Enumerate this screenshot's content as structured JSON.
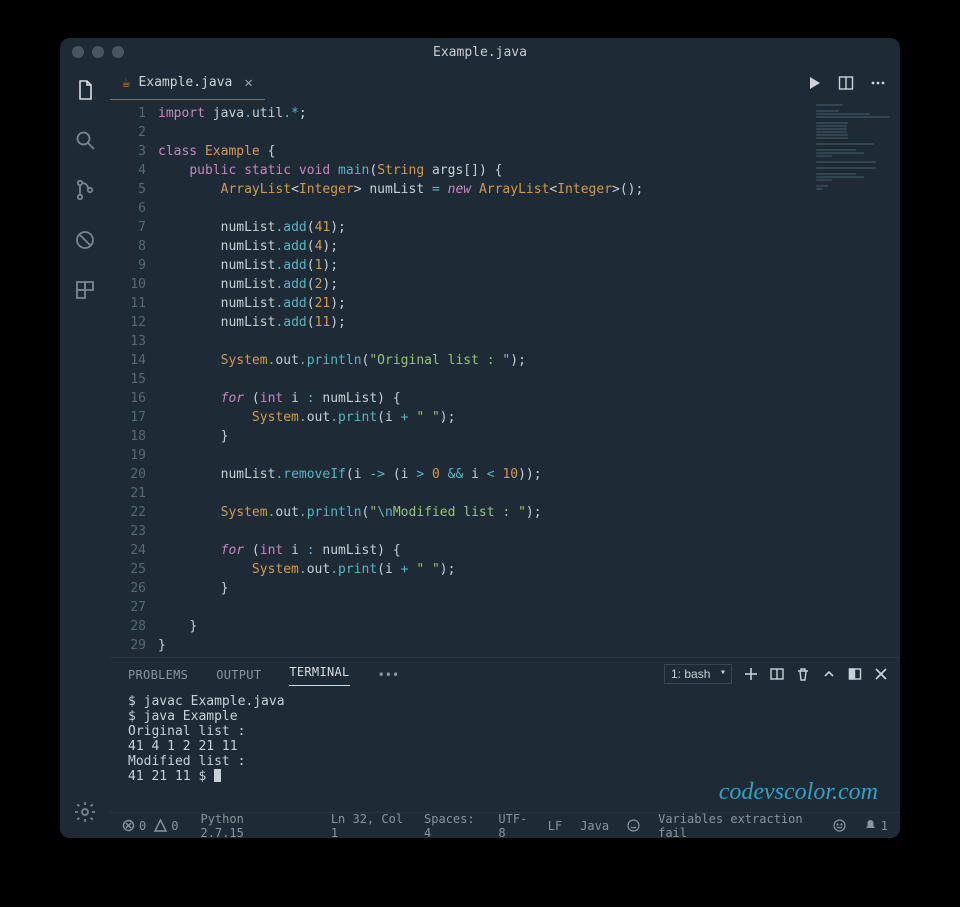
{
  "title": "Example.java",
  "tabs": [
    {
      "label": "Example.java",
      "dirty": false
    }
  ],
  "editor": {
    "lines": [
      [
        {
          "t": "kw",
          "s": "import"
        },
        {
          "t": "",
          "s": " java"
        },
        {
          "t": "op",
          "s": "."
        },
        {
          "t": "",
          "s": "util"
        },
        {
          "t": "op",
          "s": "."
        },
        {
          "t": "op",
          "s": "*"
        },
        {
          "t": "",
          "s": ";"
        }
      ],
      [],
      [
        {
          "t": "kw",
          "s": "class"
        },
        {
          "t": "",
          "s": " "
        },
        {
          "t": "cls",
          "s": "Example"
        },
        {
          "t": "",
          "s": " {"
        }
      ],
      [
        {
          "t": "ind",
          "s": "    "
        },
        {
          "t": "kw",
          "s": "public"
        },
        {
          "t": "",
          "s": " "
        },
        {
          "t": "kw",
          "s": "static"
        },
        {
          "t": "",
          "s": " "
        },
        {
          "t": "kw",
          "s": "void"
        },
        {
          "t": "",
          "s": " "
        },
        {
          "t": "fn",
          "s": "main"
        },
        {
          "t": "",
          "s": "("
        },
        {
          "t": "type",
          "s": "String"
        },
        {
          "t": "",
          "s": " args"
        },
        {
          "t": "",
          "s": "[]) {"
        }
      ],
      [
        {
          "t": "ind",
          "s": "        "
        },
        {
          "t": "type",
          "s": "ArrayList"
        },
        {
          "t": "",
          "s": "<"
        },
        {
          "t": "type",
          "s": "Integer"
        },
        {
          "t": "",
          "s": "> numList "
        },
        {
          "t": "op",
          "s": "="
        },
        {
          "t": "",
          "s": " "
        },
        {
          "t": "new",
          "s": "new"
        },
        {
          "t": "",
          "s": " "
        },
        {
          "t": "type",
          "s": "ArrayList"
        },
        {
          "t": "",
          "s": "<"
        },
        {
          "t": "type",
          "s": "Integer"
        },
        {
          "t": "",
          "s": ">();"
        }
      ],
      [],
      [
        {
          "t": "ind",
          "s": "        "
        },
        {
          "t": "",
          "s": "numList"
        },
        {
          "t": "op",
          "s": "."
        },
        {
          "t": "fn",
          "s": "add"
        },
        {
          "t": "",
          "s": "("
        },
        {
          "t": "num",
          "s": "41"
        },
        {
          "t": "",
          "s": ");"
        }
      ],
      [
        {
          "t": "ind",
          "s": "        "
        },
        {
          "t": "",
          "s": "numList"
        },
        {
          "t": "op",
          "s": "."
        },
        {
          "t": "fn",
          "s": "add"
        },
        {
          "t": "",
          "s": "("
        },
        {
          "t": "num",
          "s": "4"
        },
        {
          "t": "",
          "s": ");"
        }
      ],
      [
        {
          "t": "ind",
          "s": "        "
        },
        {
          "t": "",
          "s": "numList"
        },
        {
          "t": "op",
          "s": "."
        },
        {
          "t": "fn",
          "s": "add"
        },
        {
          "t": "",
          "s": "("
        },
        {
          "t": "num",
          "s": "1"
        },
        {
          "t": "",
          "s": ");"
        }
      ],
      [
        {
          "t": "ind",
          "s": "        "
        },
        {
          "t": "",
          "s": "numList"
        },
        {
          "t": "op",
          "s": "."
        },
        {
          "t": "fn",
          "s": "add"
        },
        {
          "t": "",
          "s": "("
        },
        {
          "t": "num",
          "s": "2"
        },
        {
          "t": "",
          "s": ");"
        }
      ],
      [
        {
          "t": "ind",
          "s": "        "
        },
        {
          "t": "",
          "s": "numList"
        },
        {
          "t": "op",
          "s": "."
        },
        {
          "t": "fn",
          "s": "add"
        },
        {
          "t": "",
          "s": "("
        },
        {
          "t": "num",
          "s": "21"
        },
        {
          "t": "",
          "s": ");"
        }
      ],
      [
        {
          "t": "ind",
          "s": "        "
        },
        {
          "t": "",
          "s": "numList"
        },
        {
          "t": "op",
          "s": "."
        },
        {
          "t": "fn",
          "s": "add"
        },
        {
          "t": "",
          "s": "("
        },
        {
          "t": "num",
          "s": "11"
        },
        {
          "t": "",
          "s": ");"
        }
      ],
      [],
      [
        {
          "t": "ind",
          "s": "        "
        },
        {
          "t": "type",
          "s": "System"
        },
        {
          "t": "op",
          "s": "."
        },
        {
          "t": "",
          "s": "out"
        },
        {
          "t": "op",
          "s": "."
        },
        {
          "t": "fn",
          "s": "println"
        },
        {
          "t": "",
          "s": "("
        },
        {
          "t": "str",
          "s": "\"Original list : \""
        },
        {
          "t": "",
          "s": ");"
        }
      ],
      [],
      [
        {
          "t": "ind",
          "s": "        "
        },
        {
          "t": "kw2",
          "s": "for"
        },
        {
          "t": "",
          "s": " ("
        },
        {
          "t": "kw",
          "s": "int"
        },
        {
          "t": "",
          "s": " i "
        },
        {
          "t": "op",
          "s": ":"
        },
        {
          "t": "",
          "s": " numList) {"
        }
      ],
      [
        {
          "t": "ind",
          "s": "            "
        },
        {
          "t": "type",
          "s": "System"
        },
        {
          "t": "op",
          "s": "."
        },
        {
          "t": "",
          "s": "out"
        },
        {
          "t": "op",
          "s": "."
        },
        {
          "t": "fn",
          "s": "print"
        },
        {
          "t": "",
          "s": "(i "
        },
        {
          "t": "op",
          "s": "+"
        },
        {
          "t": "",
          "s": " "
        },
        {
          "t": "str",
          "s": "\" \""
        },
        {
          "t": "",
          "s": ");"
        }
      ],
      [
        {
          "t": "ind",
          "s": "        "
        },
        {
          "t": "",
          "s": "}"
        }
      ],
      [],
      [
        {
          "t": "ind",
          "s": "        "
        },
        {
          "t": "",
          "s": "numList"
        },
        {
          "t": "op",
          "s": "."
        },
        {
          "t": "fn",
          "s": "removeIf"
        },
        {
          "t": "",
          "s": "(i "
        },
        {
          "t": "op",
          "s": "->"
        },
        {
          "t": "",
          "s": " (i "
        },
        {
          "t": "op",
          "s": ">"
        },
        {
          "t": "",
          "s": " "
        },
        {
          "t": "num",
          "s": "0"
        },
        {
          "t": "",
          "s": " "
        },
        {
          "t": "op",
          "s": "&&"
        },
        {
          "t": "",
          "s": " i "
        },
        {
          "t": "op",
          "s": "<"
        },
        {
          "t": "",
          "s": " "
        },
        {
          "t": "num",
          "s": "10"
        },
        {
          "t": "",
          "s": "));"
        }
      ],
      [],
      [
        {
          "t": "ind",
          "s": "        "
        },
        {
          "t": "type",
          "s": "System"
        },
        {
          "t": "op",
          "s": "."
        },
        {
          "t": "",
          "s": "out"
        },
        {
          "t": "op",
          "s": "."
        },
        {
          "t": "fn",
          "s": "println"
        },
        {
          "t": "",
          "s": "("
        },
        {
          "t": "str",
          "s": "\""
        },
        {
          "t": "esc",
          "s": "\\n"
        },
        {
          "t": "str",
          "s": "Modified list : \""
        },
        {
          "t": "",
          "s": ");"
        }
      ],
      [],
      [
        {
          "t": "ind",
          "s": "        "
        },
        {
          "t": "kw2",
          "s": "for"
        },
        {
          "t": "",
          "s": " ("
        },
        {
          "t": "kw",
          "s": "int"
        },
        {
          "t": "",
          "s": " i "
        },
        {
          "t": "op",
          "s": ":"
        },
        {
          "t": "",
          "s": " numList) {"
        }
      ],
      [
        {
          "t": "ind",
          "s": "            "
        },
        {
          "t": "type",
          "s": "System"
        },
        {
          "t": "op",
          "s": "."
        },
        {
          "t": "",
          "s": "out"
        },
        {
          "t": "op",
          "s": "."
        },
        {
          "t": "fn",
          "s": "print"
        },
        {
          "t": "",
          "s": "(i "
        },
        {
          "t": "op",
          "s": "+"
        },
        {
          "t": "",
          "s": " "
        },
        {
          "t": "str",
          "s": "\" \""
        },
        {
          "t": "",
          "s": ");"
        }
      ],
      [
        {
          "t": "ind",
          "s": "        "
        },
        {
          "t": "",
          "s": "}"
        }
      ],
      [],
      [
        {
          "t": "ind",
          "s": "    "
        },
        {
          "t": "",
          "s": "}"
        }
      ],
      [
        {
          "t": "",
          "s": "}"
        }
      ]
    ]
  },
  "panel": {
    "tabs": [
      "PROBLEMS",
      "OUTPUT",
      "TERMINAL"
    ],
    "active": 2,
    "dots": "•••",
    "terminal_select": "1: bash",
    "output_lines": [
      "$ javac Example.java",
      "$ java Example",
      "Original list :",
      "41 4 1 2 21 11",
      "Modified list :",
      "41 21 11 $ "
    ]
  },
  "watermark": "codevscolor.com",
  "status": {
    "errors": "0",
    "warnings": "0",
    "python": "Python 2.7.15",
    "cursor": "Ln 32, Col 1",
    "spaces": "Spaces: 4",
    "encoding": "UTF-8",
    "eol": "LF",
    "lang": "Java",
    "extra": "Variables extraction fail",
    "bell": "1"
  }
}
